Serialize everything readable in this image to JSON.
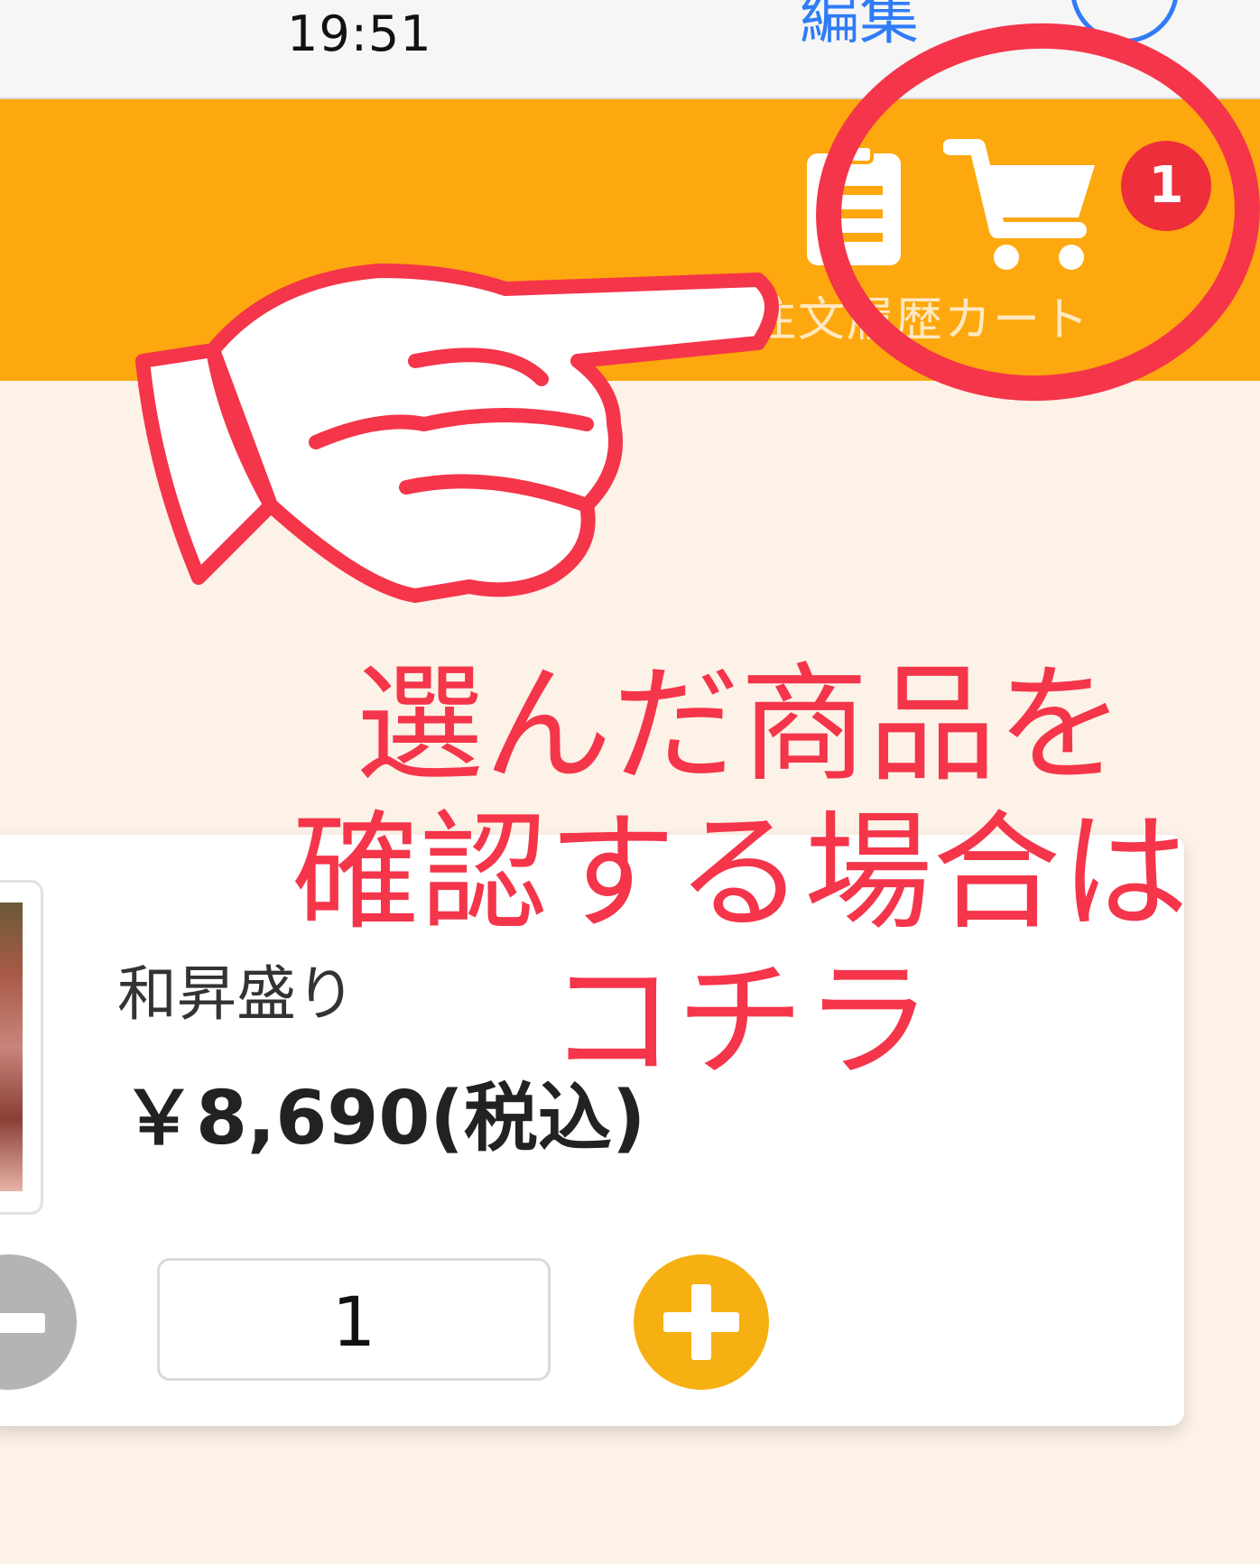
{
  "status_bar": {
    "time": "19:51",
    "edit_label": "編集"
  },
  "header": {
    "history_icon": "order-history-icon",
    "cart_icon": "shopping-cart-icon",
    "cart_badge_count": "1",
    "label": "注文履歴カート"
  },
  "product": {
    "name": "和昇盛り",
    "price": "￥8,690(税込)",
    "quantity": "1",
    "minus_icon": "minus-icon",
    "plus_icon": "plus-icon"
  },
  "annotation": {
    "line1": "選んだ商品を",
    "line2": "確認する場合は",
    "line3": "コチラ",
    "color": "#f4354a",
    "hand_icon": "pointing-hand-icon"
  },
  "colors": {
    "header": "#fda80e",
    "badge": "#ee2e3b",
    "plus": "#f6b012",
    "link": "#2f7cf6"
  }
}
